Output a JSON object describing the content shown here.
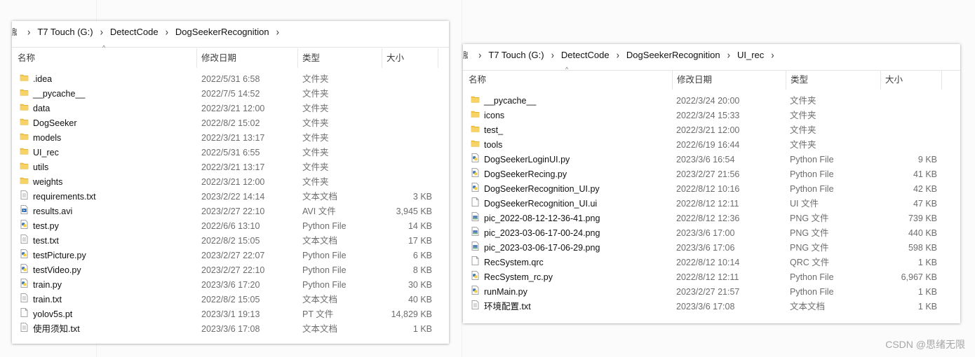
{
  "theme": {
    "folder_color": "#f4c542",
    "python_blue": "#3a74b5",
    "python_yellow": "#f2cf3b",
    "text_secondary": "#6d6d6d"
  },
  "left_window": {
    "breadcrumb_cut": "脑",
    "breadcrumb": [
      "T7 Touch (G:)",
      "DetectCode",
      "DogSeekerRecognition"
    ],
    "columns": {
      "name": "名称",
      "date": "修改日期",
      "type": "类型",
      "size": "大小"
    },
    "files": [
      {
        "name": ".idea",
        "date": "2022/5/31 6:58",
        "type": "文件夹",
        "size": "",
        "icon": "folder-icon"
      },
      {
        "name": "__pycache__",
        "date": "2022/7/5 14:52",
        "type": "文件夹",
        "size": "",
        "icon": "folder-icon"
      },
      {
        "name": "data",
        "date": "2022/3/21 12:00",
        "type": "文件夹",
        "size": "",
        "icon": "folder-icon"
      },
      {
        "name": "DogSeeker",
        "date": "2022/8/2 15:02",
        "type": "文件夹",
        "size": "",
        "icon": "folder-icon"
      },
      {
        "name": "models",
        "date": "2022/3/21 13:17",
        "type": "文件夹",
        "size": "",
        "icon": "folder-icon"
      },
      {
        "name": "UI_rec",
        "date": "2022/5/31 6:55",
        "type": "文件夹",
        "size": "",
        "icon": "folder-icon"
      },
      {
        "name": "utils",
        "date": "2022/3/21 13:17",
        "type": "文件夹",
        "size": "",
        "icon": "folder-icon"
      },
      {
        "name": "weights",
        "date": "2022/3/21 12:00",
        "type": "文件夹",
        "size": "",
        "icon": "folder-icon"
      },
      {
        "name": "requirements.txt",
        "date": "2023/2/22 14:14",
        "type": "文本文档",
        "size": "3 KB",
        "icon": "text-file-icon"
      },
      {
        "name": "results.avi",
        "date": "2023/2/27 22:10",
        "type": "AVI 文件",
        "size": "3,945 KB",
        "icon": "video-file-icon"
      },
      {
        "name": "test.py",
        "date": "2022/6/6 13:10",
        "type": "Python File",
        "size": "14 KB",
        "icon": "python-file-icon"
      },
      {
        "name": "test.txt",
        "date": "2022/8/2 15:05",
        "type": "文本文档",
        "size": "17 KB",
        "icon": "text-file-icon"
      },
      {
        "name": "testPicture.py",
        "date": "2023/2/27 22:07",
        "type": "Python File",
        "size": "6 KB",
        "icon": "python-file-icon"
      },
      {
        "name": "testVideo.py",
        "date": "2023/2/27 22:10",
        "type": "Python File",
        "size": "8 KB",
        "icon": "python-file-icon"
      },
      {
        "name": "train.py",
        "date": "2023/3/6 17:20",
        "type": "Python File",
        "size": "30 KB",
        "icon": "python-file-icon"
      },
      {
        "name": "train.txt",
        "date": "2022/8/2 15:05",
        "type": "文本文档",
        "size": "40 KB",
        "icon": "text-file-icon"
      },
      {
        "name": "yolov5s.pt",
        "date": "2023/3/1 19:13",
        "type": "PT 文件",
        "size": "14,829 KB",
        "icon": "blank-file-icon"
      },
      {
        "name": "使用须知.txt",
        "date": "2023/3/6 17:08",
        "type": "文本文档",
        "size": "1 KB",
        "icon": "text-file-icon"
      }
    ]
  },
  "right_window": {
    "breadcrumb_cut": "脑",
    "breadcrumb": [
      "T7 Touch (G:)",
      "DetectCode",
      "DogSeekerRecognition",
      "UI_rec"
    ],
    "columns": {
      "name": "名称",
      "date": "修改日期",
      "type": "类型",
      "size": "大小"
    },
    "files": [
      {
        "name": "__pycache__",
        "date": "2022/3/24 20:00",
        "type": "文件夹",
        "size": "",
        "icon": "folder-icon"
      },
      {
        "name": "icons",
        "date": "2022/3/24 15:33",
        "type": "文件夹",
        "size": "",
        "icon": "folder-icon"
      },
      {
        "name": "test_",
        "date": "2022/3/21 12:00",
        "type": "文件夹",
        "size": "",
        "icon": "folder-icon"
      },
      {
        "name": "tools",
        "date": "2022/6/19 16:44",
        "type": "文件夹",
        "size": "",
        "icon": "folder-icon"
      },
      {
        "name": "DogSeekerLoginUI.py",
        "date": "2023/3/6 16:54",
        "type": "Python File",
        "size": "9 KB",
        "icon": "python-file-icon"
      },
      {
        "name": "DogSeekerRecing.py",
        "date": "2023/2/27 21:56",
        "type": "Python File",
        "size": "41 KB",
        "icon": "python-file-icon"
      },
      {
        "name": "DogSeekerRecognition_UI.py",
        "date": "2022/8/12 10:16",
        "type": "Python File",
        "size": "42 KB",
        "icon": "python-file-icon"
      },
      {
        "name": "DogSeekerRecognition_UI.ui",
        "date": "2022/8/12 12:11",
        "type": "UI 文件",
        "size": "47 KB",
        "icon": "blank-file-icon"
      },
      {
        "name": "pic_2022-08-12-12-36-41.png",
        "date": "2022/8/12 12:36",
        "type": "PNG 文件",
        "size": "739 KB",
        "icon": "image-file-icon"
      },
      {
        "name": "pic_2023-03-06-17-00-24.png",
        "date": "2023/3/6 17:00",
        "type": "PNG 文件",
        "size": "440 KB",
        "icon": "image-file-icon"
      },
      {
        "name": "pic_2023-03-06-17-06-29.png",
        "date": "2023/3/6 17:06",
        "type": "PNG 文件",
        "size": "598 KB",
        "icon": "image-file-icon"
      },
      {
        "name": "RecSystem.qrc",
        "date": "2022/8/12 10:14",
        "type": "QRC 文件",
        "size": "1 KB",
        "icon": "blank-file-icon"
      },
      {
        "name": "RecSystem_rc.py",
        "date": "2022/8/12 12:11",
        "type": "Python File",
        "size": "6,967 KB",
        "icon": "python-file-icon"
      },
      {
        "name": "runMain.py",
        "date": "2023/2/27 21:57",
        "type": "Python File",
        "size": "1 KB",
        "icon": "python-file-icon"
      },
      {
        "name": "环境配置.txt",
        "date": "2023/3/6 17:08",
        "type": "文本文档",
        "size": "1 KB",
        "icon": "text-file-icon"
      }
    ]
  },
  "watermark": "CSDN @思绪无限"
}
